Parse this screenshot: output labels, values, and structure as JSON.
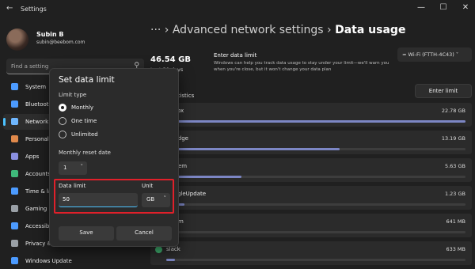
{
  "window": {
    "title": "Settings",
    "back_icon": "arrow-left-icon",
    "minimize": "—",
    "maximize": "☐",
    "close": "✕"
  },
  "user": {
    "name": "Subin B",
    "email": "subin@beebom.com"
  },
  "search": {
    "placeholder": "Find a setting"
  },
  "sidebar": {
    "items": [
      {
        "label": "System",
        "icon": "system-icon",
        "color": "#4c9bff"
      },
      {
        "label": "Bluetooth & devices",
        "icon": "bluetooth-icon",
        "color": "#4c9bff"
      },
      {
        "label": "Network & internet",
        "icon": "network-icon",
        "color": "#6fb7ff"
      },
      {
        "label": "Personalization",
        "icon": "brush-icon",
        "color": "#e0894b"
      },
      {
        "label": "Apps",
        "icon": "apps-icon",
        "color": "#8a8fe0"
      },
      {
        "label": "Accounts",
        "icon": "accounts-icon",
        "color": "#3fb97a"
      },
      {
        "label": "Time & language",
        "icon": "globe-icon",
        "color": "#4c9bff"
      },
      {
        "label": "Gaming",
        "icon": "gaming-icon",
        "color": "#9aa0a6"
      },
      {
        "label": "Accessibility",
        "icon": "accessibility-icon",
        "color": "#4c9bff"
      },
      {
        "label": "Privacy & security",
        "icon": "shield-icon",
        "color": "#9aa0a6"
      },
      {
        "label": "Windows Update",
        "icon": "update-icon",
        "color": "#4c9bff"
      }
    ]
  },
  "main": {
    "breadcrumb_prefix": "···  ›  Advanced network settings  ›  ",
    "breadcrumb_current": "Data usage",
    "network_select": "Wi-Fi (FTTH-4C43)",
    "total_usage": "46.54 GB",
    "period": "Last 30 days",
    "enter_limit_title": "Enter data limit",
    "enter_limit_desc": "Windows can help you track data usage to stay under your limit—we'll warn you when you're close, but it won't change your data plan",
    "enter_limit_button": "Enter limit",
    "usage_stats_heading": "Usage statistics",
    "apps": [
      {
        "name": "firefox",
        "value": "22.78 GB",
        "fraction": 1.0
      },
      {
        "name": "msedge",
        "value": "13.19 GB",
        "fraction": 0.58
      },
      {
        "name": "System",
        "value": "5.63 GB",
        "fraction": 0.25
      },
      {
        "name": "GoogleUpdate",
        "value": "1.23 GB",
        "fraction": 0.06
      },
      {
        "name": "steam",
        "value": "641 MB",
        "fraction": 0.03
      },
      {
        "name": "slack",
        "value": "633 MB",
        "fraction": 0.03
      }
    ]
  },
  "dialog": {
    "title": "Set data limit",
    "limit_type_label": "Limit type",
    "options": [
      "Monthly",
      "One time",
      "Unlimited"
    ],
    "selected_option": "Monthly",
    "reset_date_label": "Monthly reset date",
    "reset_date_value": "1",
    "data_limit_label": "Data limit",
    "data_limit_value": "50",
    "unit_label": "Unit",
    "unit_value": "GB",
    "save": "Save",
    "cancel": "Cancel",
    "highlight_color": "#e0202a"
  }
}
